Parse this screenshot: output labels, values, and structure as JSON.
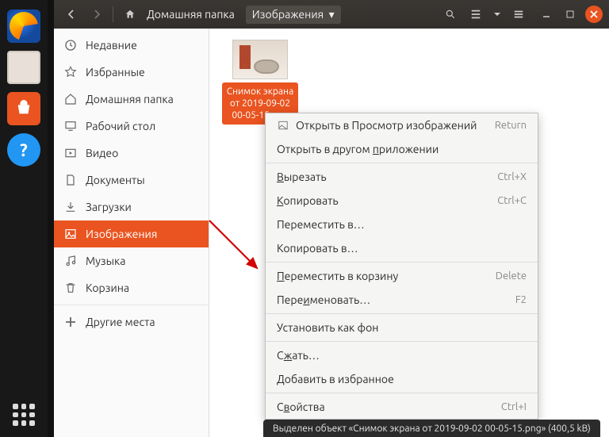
{
  "titlebar": {
    "home_label": "Домашняя папка",
    "current_label": "Изображения"
  },
  "sidebar": {
    "items": [
      {
        "icon": "clock-icon",
        "label": "Недавние"
      },
      {
        "icon": "star-icon",
        "label": "Избранные"
      },
      {
        "icon": "home-icon",
        "label": "Домашняя папка"
      },
      {
        "icon": "desktop-icon",
        "label": "Рабочий стол"
      },
      {
        "icon": "video-icon",
        "label": "Видео"
      },
      {
        "icon": "document-icon",
        "label": "Документы"
      },
      {
        "icon": "download-icon",
        "label": "Загрузки"
      },
      {
        "icon": "image-icon",
        "label": "Изображения"
      },
      {
        "icon": "music-icon",
        "label": "Музыка"
      },
      {
        "icon": "trash-icon",
        "label": "Корзина"
      }
    ],
    "other_locations": "Другие места"
  },
  "file": {
    "name": "Снимок экрана от 2019-09-02 00-05-15.png",
    "display_name": "Снимок экрана от 2019-09-02 00-05-15.png"
  },
  "context_menu": {
    "open_with_viewer": "Открыть в Просмотр изображений",
    "open_with_viewer_accel": "Return",
    "open_with_other": "Открыть в другом приложении",
    "cut": "Вырезать",
    "cut_accel": "Ctrl+X",
    "copy": "Копировать",
    "copy_accel": "Ctrl+C",
    "move_to": "Переместить в…",
    "copy_to": "Копировать в…",
    "move_to_trash": "Переместить в корзину",
    "move_to_trash_accel": "Delete",
    "rename": "Переименовать…",
    "rename_accel": "F2",
    "set_as_wallpaper": "Установить как фон",
    "compress": "Сжать…",
    "add_to_favorites": "Добавить в избранное",
    "properties": "Свойства",
    "properties_accel": "Ctrl+I"
  },
  "status": {
    "text": "Выделен объект «Снимок экрана от 2019-09-02 00-05-15.png»  (400,5 kB)"
  }
}
